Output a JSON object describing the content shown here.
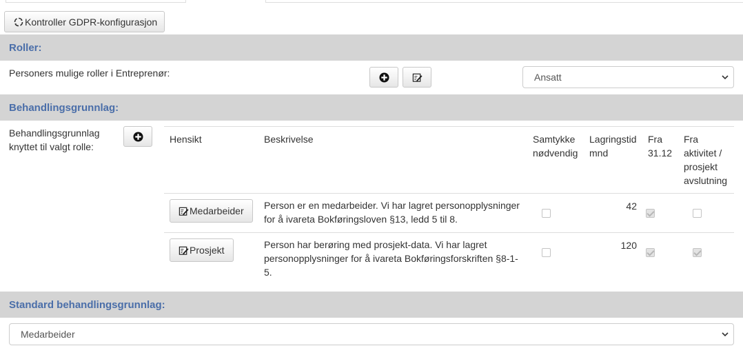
{
  "toolbar": {
    "check_label": "Kontroller GDPR-konfigurasjon"
  },
  "roles_section": {
    "title": "Roller:",
    "label": "Personers mulige roller i Entreprenør:",
    "selected_role": "Ansatt"
  },
  "basis_section": {
    "title": "Behandlingsgrunnlag:",
    "label_line1": "Behandlingsgrunnlag",
    "label_line2": "knyttet til valgt rolle:",
    "headers": {
      "purpose": "Hensikt",
      "description": "Beskrivelse",
      "consent_l1": "Samtykke",
      "consent_l2": "nødvendig",
      "storage_l1": "Lagringstid",
      "storage_l2": "mnd",
      "from_l1": "Fra",
      "from_l2": "31.12",
      "activity_l1": "Fra",
      "activity_l2": "aktivitet /",
      "activity_l3": "prosjekt",
      "activity_l4": "avslutning"
    },
    "rows": [
      {
        "purpose": "Medarbeider",
        "desc_l1": "Person er en medarbeider. Vi har lagret personopplysninger",
        "desc_l2": "for å ivareta Bokføringsloven §13, ledd 5 til 8.",
        "desc_l3": "",
        "consent": false,
        "storage": "42",
        "from_1231": true,
        "from_activity": false
      },
      {
        "purpose": "Prosjekt",
        "desc_l1": "Person har berøring med prosjekt-data. Vi har lagret",
        "desc_l2": "personopplysninger for å ivareta Bokføringsforskriften §8-1-",
        "desc_l3": "5.",
        "consent": false,
        "storage": "120",
        "from_1231": true,
        "from_activity": true
      }
    ]
  },
  "standard_section": {
    "title": "Standard behandlingsgrunnlag:",
    "selected": "Medarbeider"
  },
  "icons": {
    "refresh": "refresh-icon",
    "add": "plus-circle-icon",
    "edit": "edit-icon",
    "dropdown": "chevron-down-icon"
  },
  "colors": {
    "section_bg": "#d4d4d4",
    "section_title": "#4a6ea9"
  }
}
